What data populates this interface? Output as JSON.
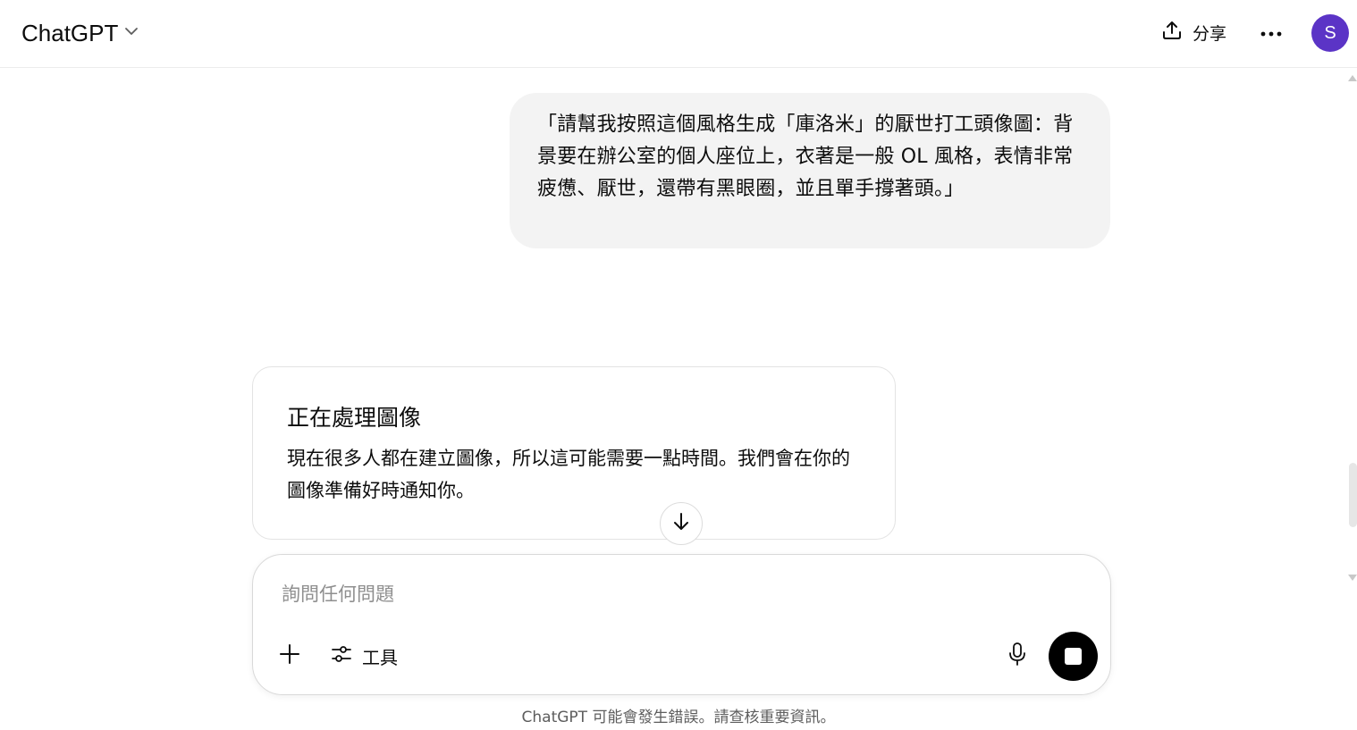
{
  "header": {
    "model_name": "ChatGPT",
    "share_label": "分享",
    "avatar_initial": "S",
    "avatar_color": "#5b34c6"
  },
  "conversation": {
    "user_message": "「請幫我按照這個風格生成「庫洛米」的厭世打工頭像圖：背景要在辦公室的個人座位上，衣著是一般 OL 風格，表情非常疲憊、厭世，還帶有黑眼圈，並且單手撐著頭。」",
    "assistant_card": {
      "title": "正在處理圖像",
      "body": "現在很多人都在建立圖像，所以這可能需要一點時間。我們會在你的圖像準備好時通知你。"
    }
  },
  "composer": {
    "placeholder": "詢問任何問題",
    "tools_label": "工具"
  },
  "footer": {
    "disclaimer": "ChatGPT 可能會發生錯誤。請查核重要資訊。"
  },
  "icons": [
    "chevron-down-icon",
    "upload-icon",
    "ellipsis-icon",
    "arrow-down-icon",
    "plus-icon",
    "sliders-icon",
    "microphone-icon",
    "stop-icon"
  ]
}
